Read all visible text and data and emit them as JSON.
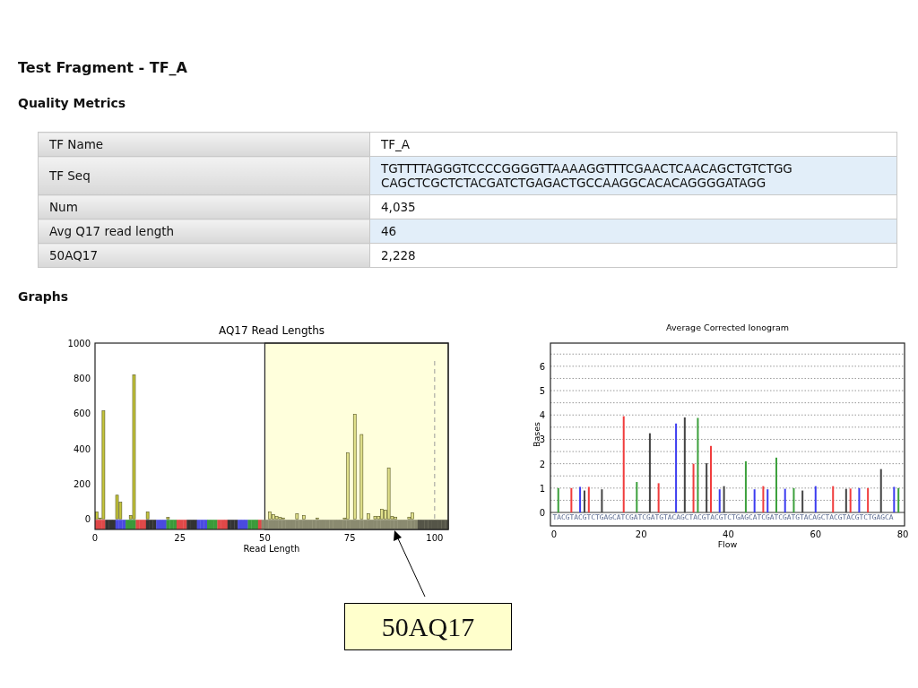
{
  "title": "Test Fragment - TF_A",
  "quality_metrics": {
    "heading": "Quality Metrics",
    "rows": [
      {
        "label": "TF Name",
        "value": "TF_A"
      },
      {
        "label": "TF Seq",
        "value": "TGTTTTAGGGTCCCCGGGGTTAAAAGGTTTCGAACTCAACAGCTGTCTGG CAGCTCGCTCTACGATCTGAGACTGCCAAGGCACACAGGGGATAGG"
      },
      {
        "label": "Num",
        "value": "4,035"
      },
      {
        "label": "Avg Q17 read length",
        "value": "46"
      },
      {
        "label": "50AQ17",
        "value": "2,228"
      }
    ]
  },
  "graphs": {
    "heading": "Graphs",
    "read_lengths": {
      "chart_data": {
        "type": "bar",
        "title": "AQ17 Read Lengths",
        "xlabel": "Read Length",
        "x": [
          0,
          1,
          2,
          6,
          7,
          10,
          11,
          15,
          21,
          51,
          52,
          53,
          54,
          55,
          59,
          61,
          65,
          73,
          74,
          76,
          78,
          80,
          82,
          83,
          84,
          85,
          86,
          87,
          88,
          92,
          93
        ],
        "series": [
          {
            "color": "#c4c43a",
            "values": [
              40,
              5,
              615,
              135,
              95,
              20,
              820,
              40,
              8,
              40,
              25,
              15,
              8,
              5,
              30,
              20,
              5,
              5,
              375,
              595,
              480,
              30,
              15,
              15,
              55,
              50,
              290,
              15,
              10,
              10,
              35
            ]
          }
        ],
        "xlim": [
          0,
          104
        ],
        "ylim": [
          -60,
          1000
        ],
        "xticks": [
          0,
          25,
          50,
          75,
          100
        ],
        "yticks": [
          0,
          200,
          400,
          600,
          800,
          1000
        ],
        "bands": [
          {
            "axis": "x",
            "from": 50,
            "to": 104
          }
        ],
        "ref_lines": [
          {
            "axis": "x",
            "value": 100
          }
        ]
      }
    },
    "ionogram": {
      "chart_data": {
        "type": "bar",
        "title": "Average Corrected Ionogram",
        "xlabel": "Flow",
        "ylabel": "Bases",
        "x": [
          1,
          4,
          6,
          7,
          8,
          11,
          16,
          19,
          22,
          24,
          28,
          30,
          32,
          33,
          35,
          36,
          38,
          39,
          44,
          46,
          48,
          49,
          51,
          53,
          55,
          57,
          60,
          64,
          67,
          68,
          70,
          72,
          75,
          78,
          79
        ],
        "series": [
          {
            "color": "#3ca03c",
            "values": [
              1.0,
              null,
              null,
              null,
              null,
              null,
              null,
              1.25,
              null,
              null,
              null,
              null,
              null,
              3.88,
              null,
              null,
              null,
              null,
              2.1,
              null,
              null,
              null,
              2.25,
              null,
              1.0,
              null,
              null,
              null,
              null,
              null,
              null,
              null,
              null,
              null,
              1.0
            ]
          },
          {
            "color": "#3c3cf0",
            "values": [
              null,
              null,
              1.05,
              null,
              null,
              null,
              null,
              null,
              null,
              null,
              3.65,
              null,
              null,
              null,
              null,
              null,
              0.95,
              null,
              null,
              0.95,
              null,
              0.95,
              null,
              0.97,
              null,
              null,
              1.08,
              null,
              null,
              null,
              1.0,
              null,
              null,
              1.05,
              null
            ]
          },
          {
            "color": "#444444",
            "values": [
              null,
              null,
              null,
              0.9,
              null,
              0.95,
              null,
              null,
              3.25,
              null,
              null,
              3.9,
              null,
              null,
              2.02,
              null,
              null,
              1.08,
              null,
              null,
              null,
              null,
              null,
              null,
              null,
              0.9,
              null,
              null,
              0.97,
              null,
              null,
              null,
              1.78,
              null,
              null
            ]
          },
          {
            "color": "#f03c3c",
            "values": [
              null,
              1.0,
              null,
              null,
              1.05,
              null,
              3.95,
              null,
              null,
              1.2,
              null,
              null,
              2.0,
              null,
              null,
              2.73,
              null,
              null,
              null,
              null,
              1.08,
              null,
              null,
              null,
              null,
              null,
              null,
              1.08,
              null,
              0.98,
              null,
              1.0,
              null,
              null,
              null
            ]
          }
        ],
        "xlim": [
          -0.8,
          80.4
        ],
        "ylim": [
          -0.55,
          6.95
        ],
        "xticks": [
          0,
          20,
          40,
          60,
          80
        ],
        "yticks": [
          0,
          1,
          2,
          3,
          4,
          5,
          6
        ],
        "grid": true
      },
      "flow_order": "TACGTACGTCTGAGCATCGATCGATGTACAGCTACGTACGTCTGAGCATCGATCGATGTACAGCTACGTACGTCTGAGCA"
    }
  },
  "callout": {
    "text": "50AQ17"
  }
}
